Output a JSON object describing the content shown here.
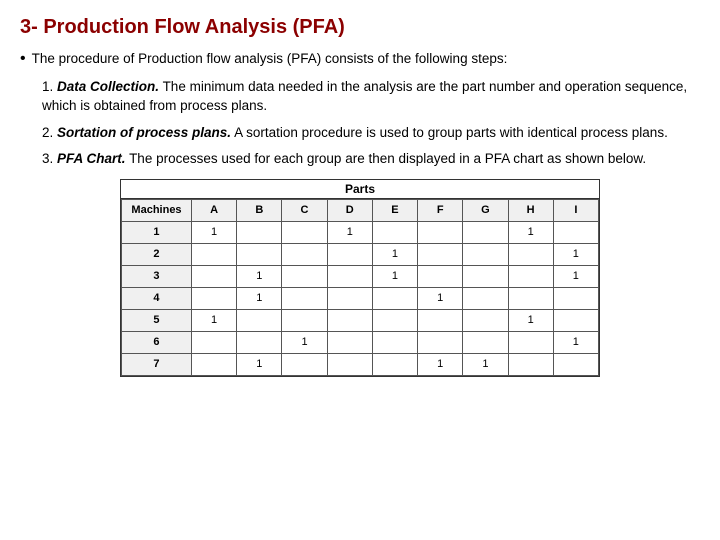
{
  "title": "3- Production Flow Analysis (PFA)",
  "bullet": "The procedure of Production flow analysis (PFA) consists of the following steps:",
  "steps": [
    {
      "number": "1.",
      "label": "Data Collection.",
      "text": "The minimum data needed in the analysis are the part number and operation sequence, which is obtained from process plans."
    },
    {
      "number": "2.",
      "label": "Sortation of process plans.",
      "text": "A sortation procedure is used to group parts with identical process plans."
    },
    {
      "number": "3.",
      "label": "PFA Chart.",
      "text": "The processes used for each group are then displayed in a PFA chart as shown below."
    }
  ],
  "chart": {
    "parts_label": "Parts",
    "columns": [
      "Machines",
      "A",
      "B",
      "C",
      "D",
      "E",
      "F",
      "G",
      "H",
      "I"
    ],
    "rows": [
      {
        "machine": "1",
        "cells": [
          "1",
          "",
          "",
          "1",
          "",
          "",
          "",
          "1",
          ""
        ]
      },
      {
        "machine": "2",
        "cells": [
          "",
          "",
          "",
          "",
          "1",
          "",
          "",
          "",
          "1"
        ]
      },
      {
        "machine": "3",
        "cells": [
          "",
          "1",
          "",
          "",
          "1",
          "",
          "",
          "",
          "1"
        ]
      },
      {
        "machine": "4",
        "cells": [
          "",
          "1",
          "",
          "",
          "",
          "1",
          "",
          "",
          ""
        ]
      },
      {
        "machine": "5",
        "cells": [
          "1",
          "",
          "",
          "",
          "",
          "",
          "",
          "1",
          ""
        ]
      },
      {
        "machine": "6",
        "cells": [
          "",
          "",
          "1",
          "",
          "",
          "",
          "",
          "",
          "1"
        ]
      },
      {
        "machine": "7",
        "cells": [
          "",
          "1",
          "",
          "",
          "",
          "1",
          "1",
          "",
          ""
        ]
      }
    ]
  }
}
